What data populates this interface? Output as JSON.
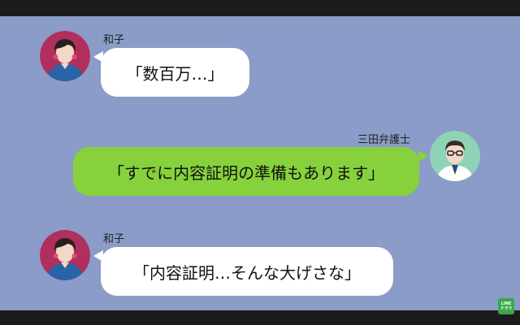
{
  "messages": [
    {
      "sender": "和子",
      "text": "「数百万…」",
      "side": "left"
    },
    {
      "sender": "三田弁護士",
      "text": "「すでに内容証明の準備もあります」",
      "side": "right"
    },
    {
      "sender": "和子",
      "text": "「内容証明…そんな大げさな」",
      "side": "left"
    }
  ],
  "logo": {
    "line1": "LINE",
    "line2": "ドラマ"
  },
  "colors": {
    "chat_background": "#8a9cc7",
    "incoming_bubble": "#ffffff",
    "outgoing_bubble": "#87d23c"
  },
  "icons": {
    "kazuko_avatar": "woman-avatar-icon",
    "lawyer_avatar": "man-with-glasses-avatar-icon"
  }
}
